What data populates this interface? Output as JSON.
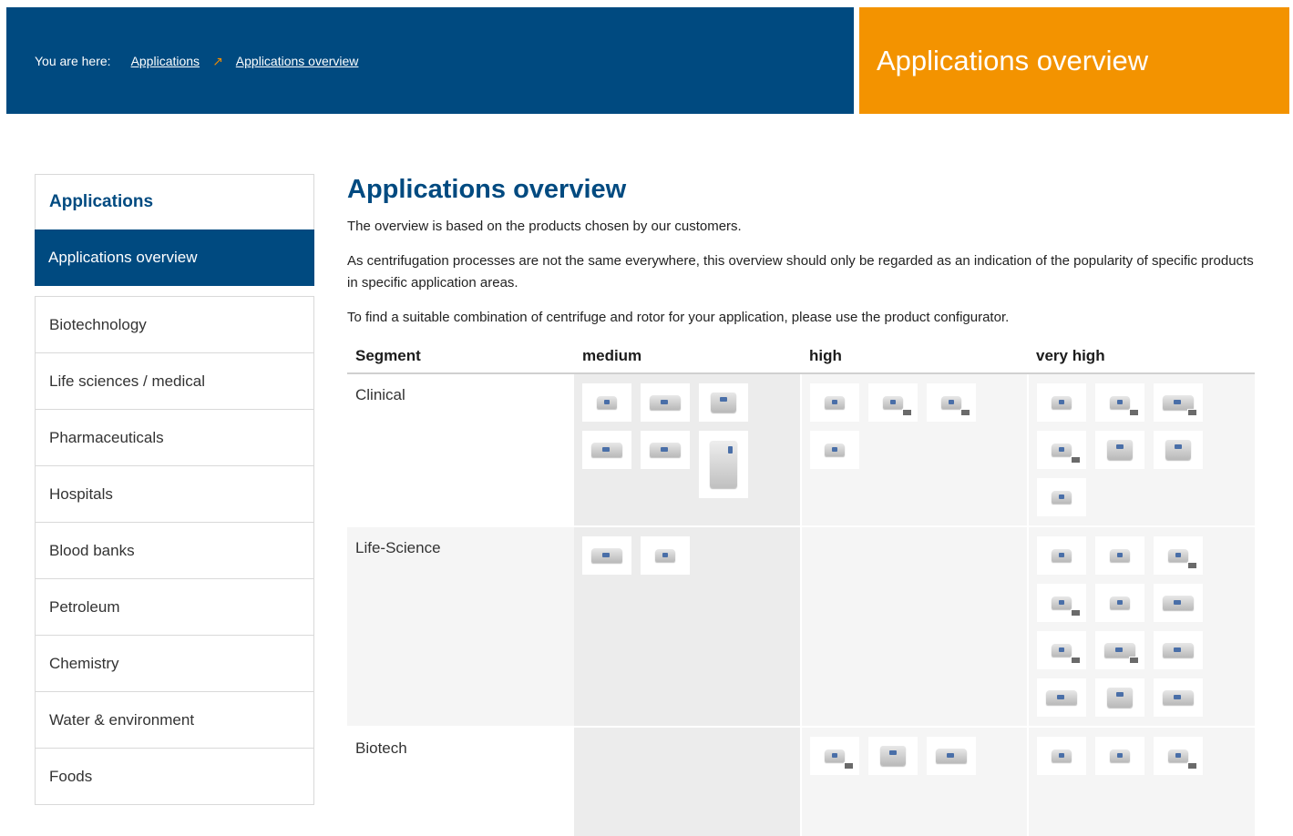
{
  "header": {
    "you_are_here": "You are here:",
    "crumbs": [
      {
        "label": "Applications"
      },
      {
        "label": "Applications overview"
      }
    ],
    "crumb_separator": "↗",
    "banner_title": "Applications overview"
  },
  "sidebar": {
    "heading": "Applications",
    "active": "Applications overview",
    "items": [
      {
        "label": "Biotechnology"
      },
      {
        "label": "Life sciences / medical"
      },
      {
        "label": "Pharmaceuticals"
      },
      {
        "label": "Hospitals"
      },
      {
        "label": "Blood banks"
      },
      {
        "label": "Petroleum"
      },
      {
        "label": "Chemistry"
      },
      {
        "label": "Water & environment"
      },
      {
        "label": "Foods"
      }
    ]
  },
  "main": {
    "title": "Applications overview",
    "paragraphs": [
      "The overview is based on the products chosen by our customers.",
      "As centrifugation processes are not the same everywhere, this overview should only be regarded as an indication of the popularity of specific products in specific application areas.",
      "To find a suitable combination of centrifuge and rotor for your application, please use the product configurator."
    ],
    "table": {
      "headers": [
        "Segment",
        "medium",
        "high",
        "very high"
      ],
      "rows": [
        {
          "segment": "Clinical"
        },
        {
          "segment": "Life-Science"
        },
        {
          "segment": "Biotech"
        }
      ]
    }
  },
  "colors": {
    "brand_blue": "#004a80",
    "brand_orange": "#f39300"
  }
}
